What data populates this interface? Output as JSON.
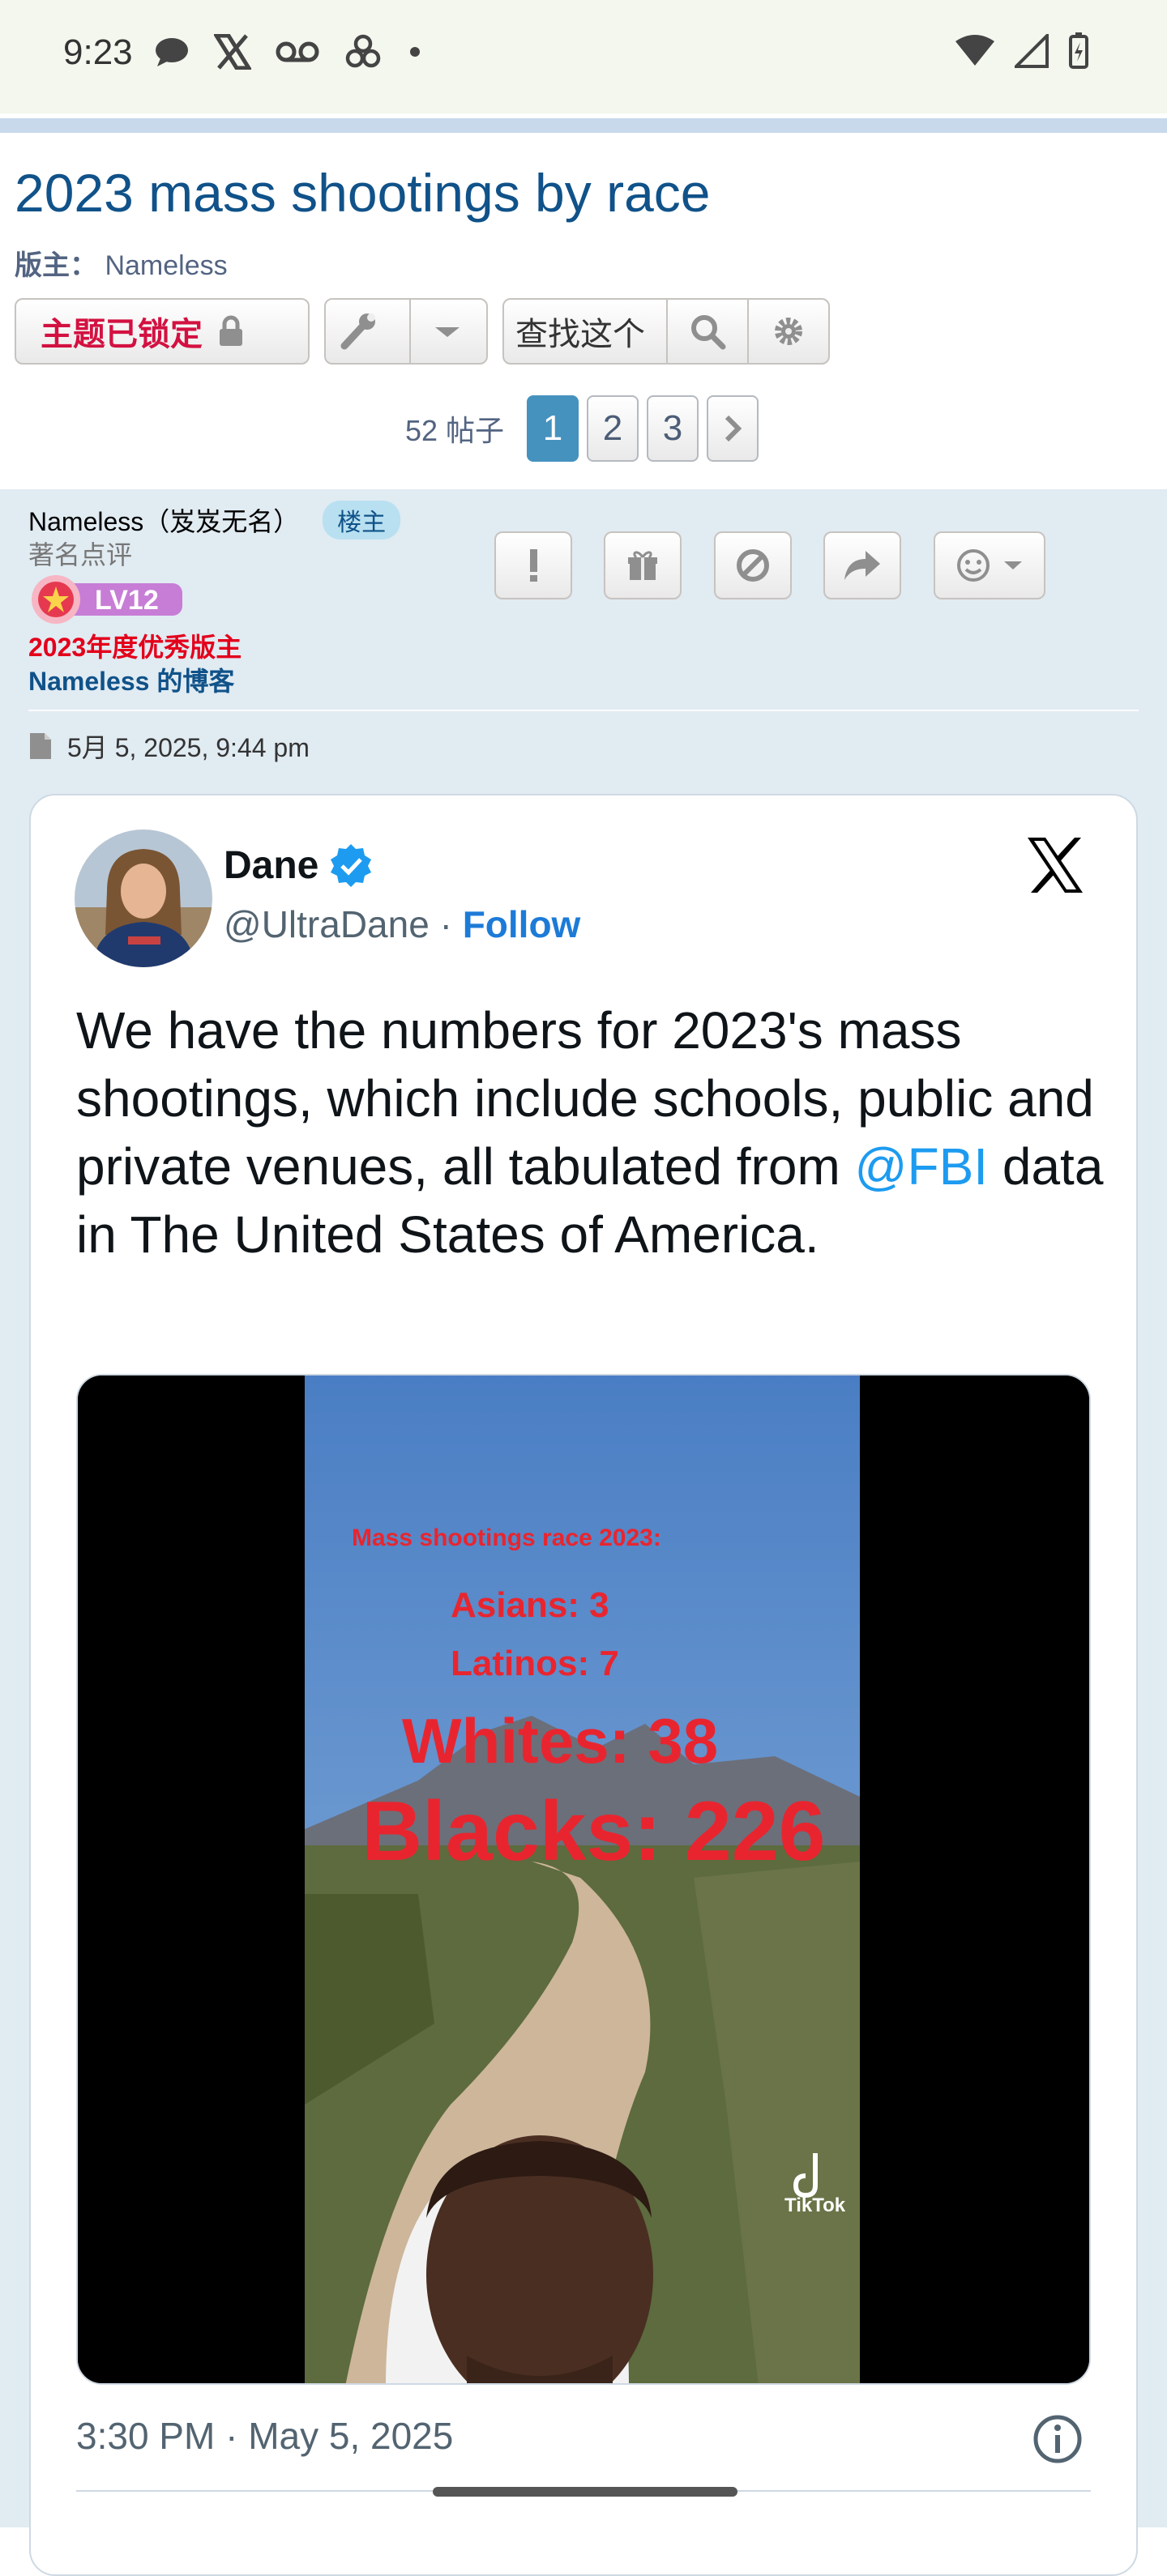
{
  "status_bar": {
    "time": "9:23"
  },
  "topic": {
    "title": "2023 mass shootings by race",
    "moderator_label": "版主：",
    "moderator_name": "Nameless"
  },
  "toolbar": {
    "locked_label": "主题已锁定",
    "search_label": "查找这个"
  },
  "pagination": {
    "post_count": "52 帖子",
    "pages": [
      "1",
      "2",
      "3"
    ],
    "active_page": "1"
  },
  "post": {
    "author": "Nameless（岌岌无名）",
    "owner_badge": "楼主",
    "rank": "著名点评",
    "level": "LV12",
    "award": "2023年度优秀版主",
    "blog_link": "Nameless 的博客",
    "date": "5月 5, 2025, 9:44 pm"
  },
  "tweet": {
    "name": "Dane",
    "handle": "@UltraDane",
    "separator": "·",
    "follow": "Follow",
    "text_before": "We have the numbers for 2023's mass shootings, which include schools, public and private venues, all tabulated from ",
    "mention": "@FBI",
    "text_after": "  data in The United States of America.",
    "timestamp": "3:30 PM · May 5, 2025"
  },
  "video": {
    "heading": "Mass shootings race 2023:",
    "lines": [
      "Asians: 3",
      "Latinos: 7",
      "Whites: 38",
      "Blacks: 226"
    ],
    "watermark": "TikTok"
  },
  "colors": {
    "link_blue": "#105289",
    "locked_red": "#d31141",
    "active_page": "#4692bf",
    "follow_blue": "#1d7bd8",
    "post_bg": "#e1ebf2"
  }
}
